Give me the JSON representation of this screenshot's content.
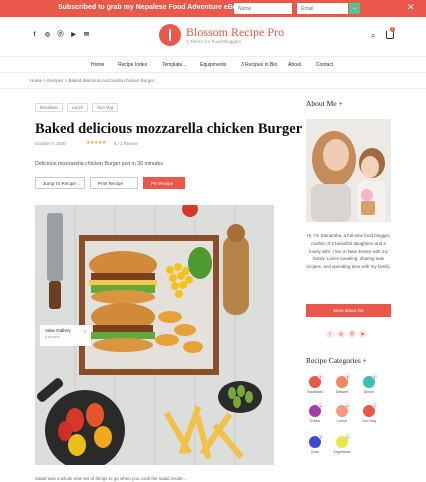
{
  "topbar": {
    "message": "Subscribed to grab my Nepalese Food Adventure eBook!",
    "name_placeholder": "Name",
    "email_placeholder": "Email",
    "close_glyph": "✕",
    "go_glyph": "→"
  },
  "header": {
    "site_title": "Blossom Recipe Pro",
    "tagline": "A Theme for Food Bloggers",
    "social_icons": [
      "facebook-icon",
      "instagram-icon",
      "pinterest-icon",
      "youtube-icon",
      "email-icon"
    ],
    "social_glyphs": [
      "f",
      "◎",
      "ⓟ",
      "▶",
      "✉"
    ],
    "search_glyph": "⌕",
    "cart_count": "1"
  },
  "nav": {
    "items": [
      "Home",
      "Recipe Index",
      "Template...",
      "Equipments",
      "3 Recipes in Bio",
      "About",
      "Contact"
    ]
  },
  "breadcrumb": {
    "text": "Home  >  Recipes  >  Baked delicious mozzarella chicken Burger"
  },
  "article": {
    "tags": [
      "Breakfast",
      "Lunch",
      "Non Veg"
    ],
    "title": "Baked delicious mozzarella chicken Burger",
    "date": "October 7, 2020",
    "stars": "★★★★★",
    "rating": "5 / 1 Review",
    "description": "Delicious mozzarella chicken Burger just in 30 minutes",
    "buttons": {
      "jump": "Jump To Recipe",
      "print": "Print Recipe",
      "pin": "Pin Recipe"
    },
    "gallery": {
      "label": "View Gallery",
      "count": "8 photos",
      "arrow": "→"
    },
    "bottom_text": "Salad was a whole new set of things to go when you cook the salad inside..."
  },
  "sidebar": {
    "about_title": "About Me +",
    "bio": "Hi, I'm Samantha, a full-time food blogger, mother of 2 beautiful daughters and a lovely wife. I live in New Jersey with my family. Loves traveling, sharing new recipes, and spending time with my family.",
    "more_button": "More about me",
    "social_glyphs": [
      "f",
      "◎",
      "ⓟ",
      "▶"
    ],
    "categories_title": "Recipe Categories +",
    "categories": [
      {
        "label": "Breakfast",
        "count": "3",
        "color": "#e9584a"
      },
      {
        "label": "Dessert",
        "count": "5",
        "color": "#f08a5d"
      },
      {
        "label": "Dinner",
        "count": "4",
        "color": "#3bbfad"
      },
      {
        "label": "Drinks",
        "count": "2",
        "color": "#a13fa6"
      },
      {
        "label": "Lunch",
        "count": "6",
        "color": "#f49b7e"
      },
      {
        "label": "Non Veg",
        "count": "3",
        "color": "#e9584a"
      },
      {
        "label": "Soup",
        "count": "2",
        "color": "#3d4bd1"
      },
      {
        "label": "Vegetarian",
        "count": "4",
        "color": "#e7e84b"
      }
    ]
  }
}
